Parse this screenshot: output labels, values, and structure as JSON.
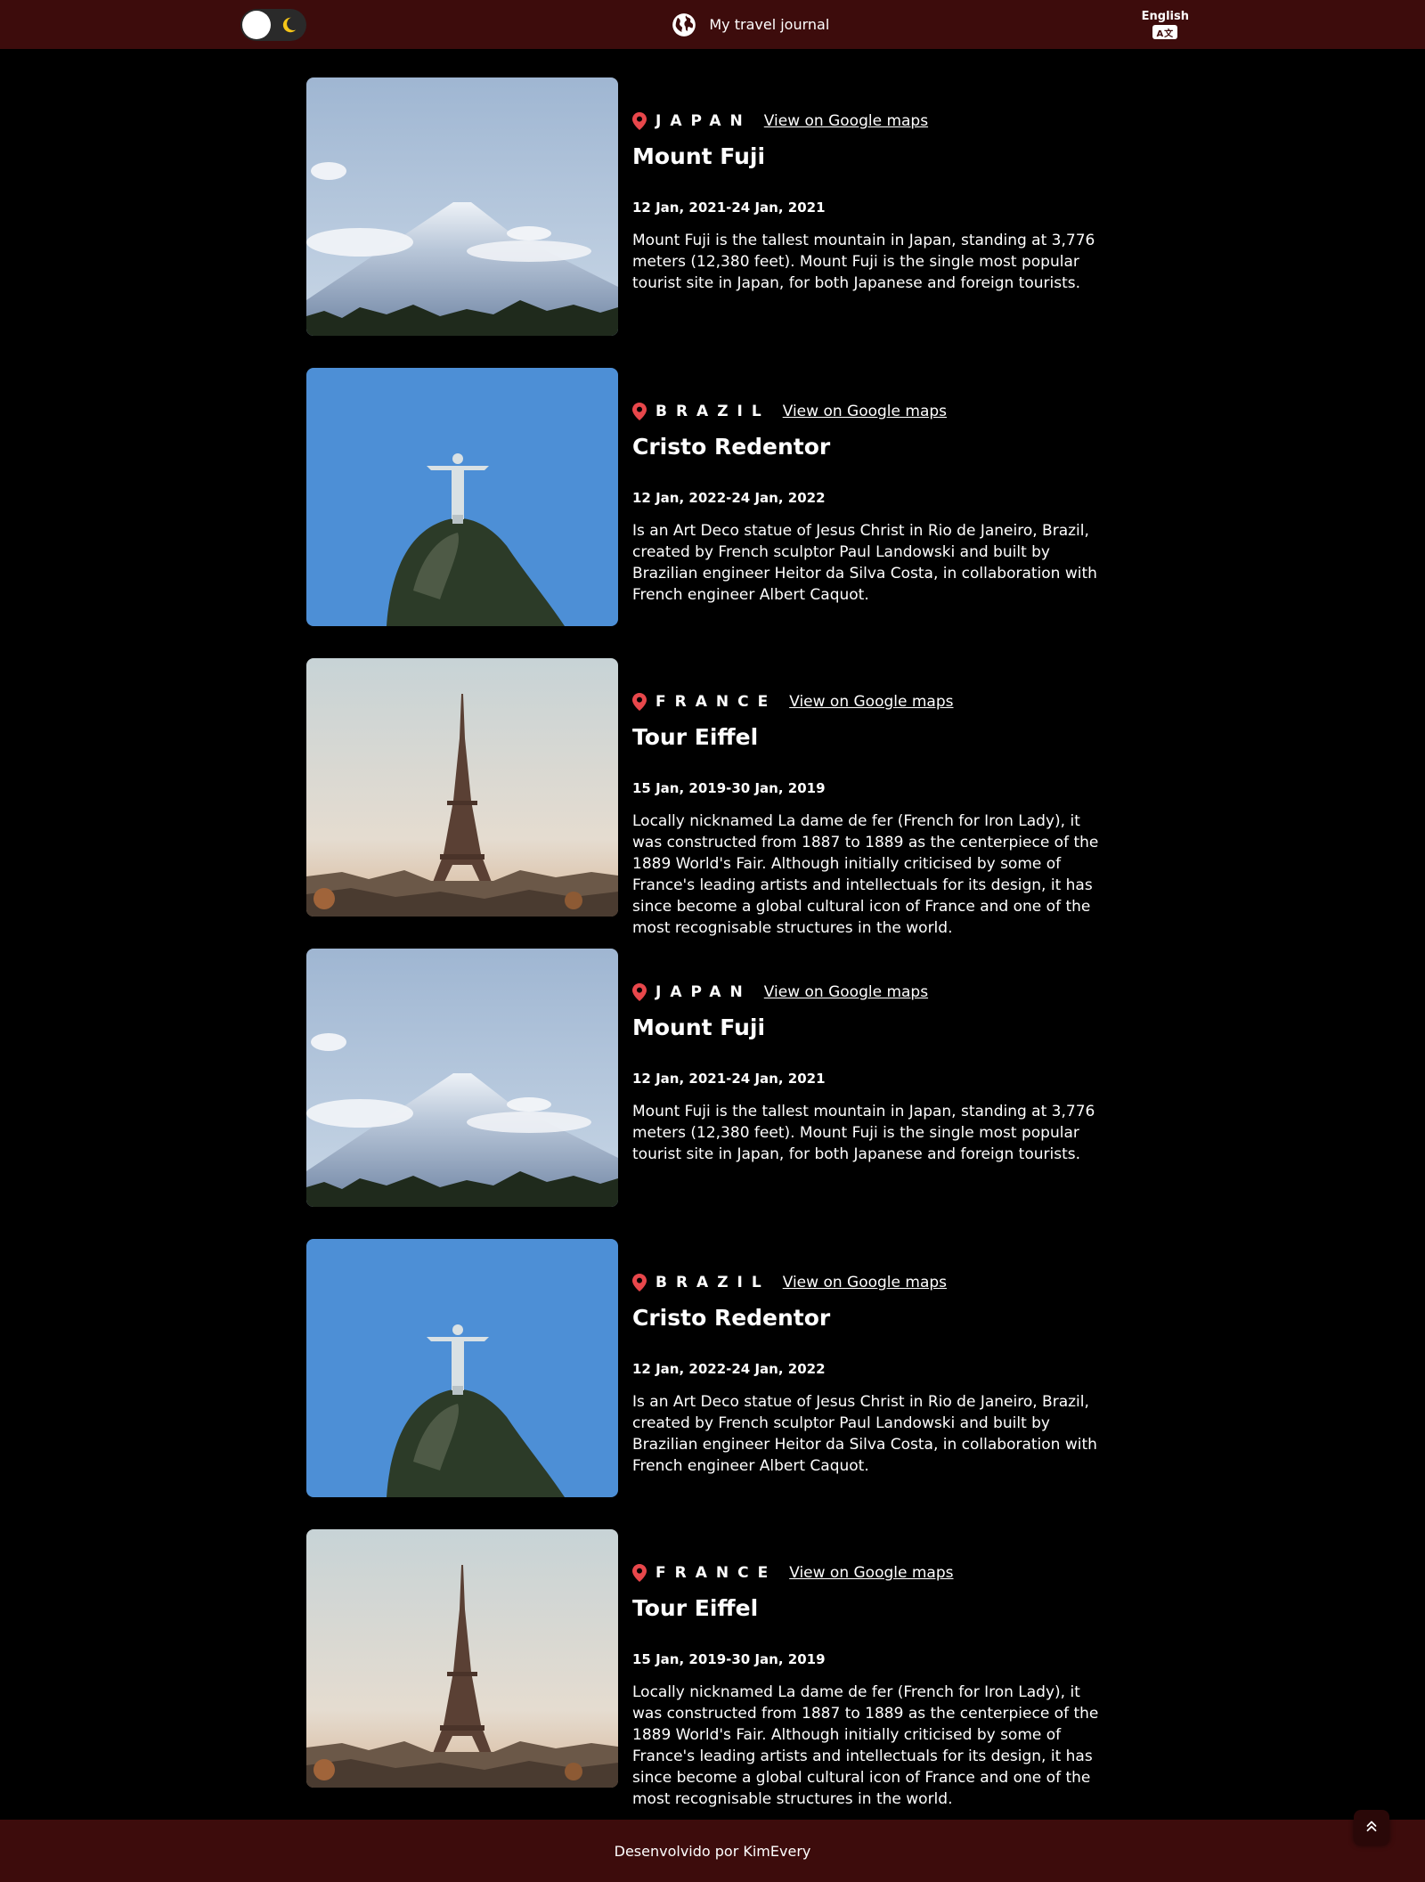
{
  "header": {
    "title": "My travel journal",
    "language": "English",
    "language_icon": "translate-icon",
    "theme_toggle_icon": "moon-icon"
  },
  "entries": [
    {
      "country": "JAPAN",
      "maps_link": "View on Google maps",
      "place": "Mount Fuji",
      "dates": "12 Jan, 2021-24 Jan, 2021",
      "description": "Mount Fuji is the tallest mountain in Japan, standing at 3,776 meters (12,380 feet). Mount Fuji is the single most popular tourist site in Japan, for both Japanese and foreign tourists.",
      "image": "mountain"
    },
    {
      "country": "BRAZIL",
      "maps_link": "View on Google maps",
      "place": "Cristo Redentor",
      "dates": "12 Jan, 2022-24 Jan, 2022",
      "description": "Is an Art Deco statue of Jesus Christ in Rio de Janeiro, Brazil, created by French sculptor Paul Landowski and built by Brazilian engineer Heitor da Silva Costa, in collaboration with French engineer Albert Caquot.",
      "image": "statue"
    },
    {
      "country": "FRANCE",
      "maps_link": "View on Google maps",
      "place": "Tour Eiffel",
      "dates": "15 Jan, 2019-30 Jan, 2019",
      "description": "Locally nicknamed La dame de fer (French for Iron Lady), it was constructed from 1887 to 1889 as the centerpiece of the 1889 World's Fair. Although initially criticised by some of France's leading artists and intellectuals for its design, it has since become a global cultural icon of France and one of the most recognisable structures in the world.",
      "image": "tower"
    },
    {
      "country": "JAPAN",
      "maps_link": "View on Google maps",
      "place": "Mount Fuji",
      "dates": "12 Jan, 2021-24 Jan, 2021",
      "description": "Mount Fuji is the tallest mountain in Japan, standing at 3,776 meters (12,380 feet). Mount Fuji is the single most popular tourist site in Japan, for both Japanese and foreign tourists.",
      "image": "mountain"
    },
    {
      "country": "BRAZIL",
      "maps_link": "View on Google maps",
      "place": "Cristo Redentor",
      "dates": "12 Jan, 2022-24 Jan, 2022",
      "description": "Is an Art Deco statue of Jesus Christ in Rio de Janeiro, Brazil, created by French sculptor Paul Landowski and built by Brazilian engineer Heitor da Silva Costa, in collaboration with French engineer Albert Caquot.",
      "image": "statue"
    },
    {
      "country": "FRANCE",
      "maps_link": "View on Google maps",
      "place": "Tour Eiffel",
      "dates": "15 Jan, 2019-30 Jan, 2019",
      "description": "Locally nicknamed La dame de fer (French for Iron Lady), it was constructed from 1887 to 1889 as the centerpiece of the 1889 World's Fair. Although initially criticised by some of France's leading artists and intellectuals for its design, it has since become a global cultural icon of France and one of the most recognisable structures in the world.",
      "image": "tower"
    }
  ],
  "footer": {
    "credit": "Desenvolvido por KimEvery"
  },
  "colors": {
    "header_bg": "#3d0c0c",
    "page_bg": "#000000",
    "pin": "#e8474b",
    "moon": "#f5c518"
  }
}
